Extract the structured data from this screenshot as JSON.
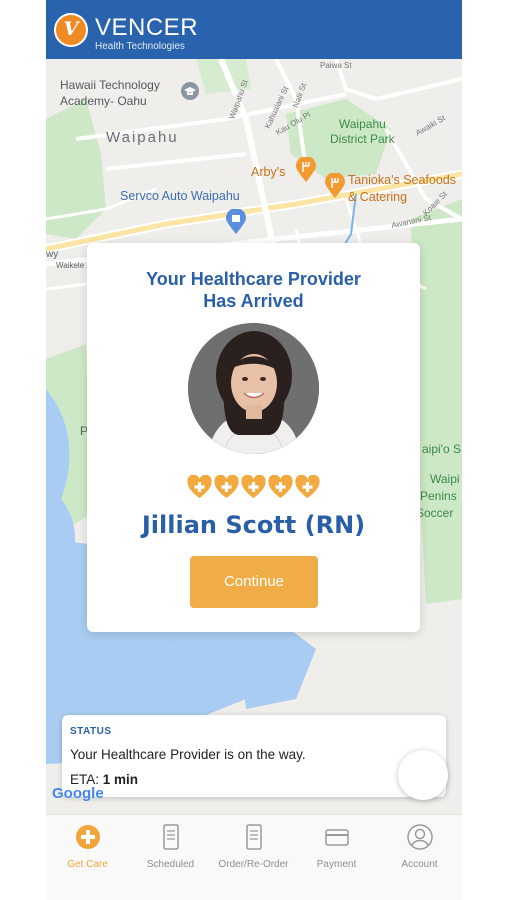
{
  "header": {
    "logo_letter": "V",
    "brand": "VENCER",
    "brand_sub": "Health Technologies"
  },
  "map": {
    "labels": {
      "academy": "Hawaii Technology\nAcademy- Oahu",
      "waipahu": "Waipahu",
      "park": "Waipahu\nDistrict Park",
      "arbys": "Arby's",
      "tanioka": "Tanioka's Seafoods\n& Catering",
      "servco": "Servco Auto Waipahu",
      "waipio": "aipi'o S",
      "waipi": "Waipi",
      "penins": "Penins",
      "soccer": "Soccer",
      "pe": "Pe",
      "wy": "wy",
      "waikele": "Waikele",
      "google": "Google"
    },
    "streets": {
      "paiwa": "Paiwa St",
      "waipahu_st": "Waipahu St",
      "kahualani": "Kahualani St",
      "nalii": "Nalii St",
      "kauolu": "Kau Olu Pl",
      "awaiki": "Awaiki St",
      "awanani": "Awanani St",
      "koaie": "Koaie St"
    }
  },
  "card": {
    "title_line1": "Your Healthcare Provider",
    "title_line2": "Has Arrived",
    "rating": 5,
    "provider_name": "Jillian Scott (RN)",
    "continue_label": "Continue"
  },
  "status": {
    "heading": "STATUS",
    "message": "Your Healthcare Provider is on the way.",
    "eta_label": "ETA:",
    "eta_value": "1 min"
  },
  "tabs": [
    {
      "label": "Get Care",
      "icon": "plus-circle-icon",
      "active": true
    },
    {
      "label": "Scheduled",
      "icon": "document-icon",
      "active": false
    },
    {
      "label": "Order/Re-Order",
      "icon": "document-icon",
      "active": false
    },
    {
      "label": "Payment",
      "icon": "credit-card-icon",
      "active": false
    },
    {
      "label": "Account",
      "icon": "user-icon",
      "active": false
    }
  ],
  "colors": {
    "brand_blue": "#2a63ad",
    "accent_orange": "#f0ac46",
    "heart_orange": "#f2a940"
  }
}
